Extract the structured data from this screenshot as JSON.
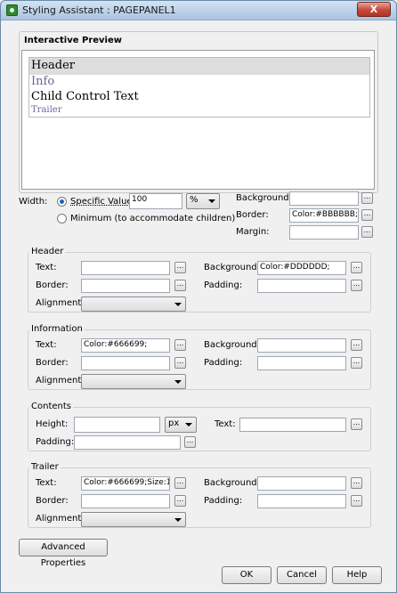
{
  "window": {
    "title": "Styling Assistant : PAGEPANEL1",
    "close_label": "X"
  },
  "preview": {
    "title": "Interactive Preview",
    "header": "Header",
    "info": "Info",
    "child": "Child Control Text",
    "trailer": "Trailer"
  },
  "width": {
    "label": "Width:",
    "specific_label": "Specific Value",
    "value": "100",
    "unit": "%",
    "minimum_label": "Minimum (to accommodate children)"
  },
  "panel": {
    "background_label": "Background:",
    "background_value": "",
    "border_label": "Border:",
    "border_value": "Color:#BBBBBB;/",
    "margin_label": "Margin:",
    "margin_value": ""
  },
  "header_group": {
    "title": "Header",
    "text_label": "Text:",
    "text_value": "",
    "background_label": "Background:",
    "background_value": "Color:#DDDDDD;",
    "border_label": "Border:",
    "border_value": "",
    "padding_label": "Padding:",
    "padding_value": "",
    "alignment_label": "Alignment:",
    "alignment_value": ""
  },
  "info_group": {
    "title": "Information",
    "text_label": "Text:",
    "text_value": "Color:#666699;",
    "background_label": "Background:",
    "background_value": "",
    "border_label": "Border:",
    "border_value": "",
    "padding_label": "Padding:",
    "padding_value": "",
    "alignment_label": "Alignment:",
    "alignment_value": ""
  },
  "contents_group": {
    "title": "Contents",
    "height_label": "Height:",
    "height_value": "",
    "height_unit": "px",
    "text_label": "Text:",
    "text_value": "",
    "padding_label": "Padding:",
    "padding_value": ""
  },
  "trailer_group": {
    "title": "Trailer",
    "text_label": "Text:",
    "text_value": "Color:#666699;Size:1",
    "background_label": "Background:",
    "background_value": "",
    "border_label": "Border:",
    "border_value": "",
    "padding_label": "Padding:",
    "padding_value": "",
    "alignment_label": "Alignment:",
    "alignment_value": ""
  },
  "buttons": {
    "advanced": "Advanced Properties",
    "ok": "OK",
    "cancel": "Cancel",
    "help": "Help"
  },
  "ellipsis": "...",
  "colors": {
    "preview_header_bg": "#DDDDDD",
    "preview_info_text": "#666699",
    "preview_border": "#BBBBBB"
  }
}
